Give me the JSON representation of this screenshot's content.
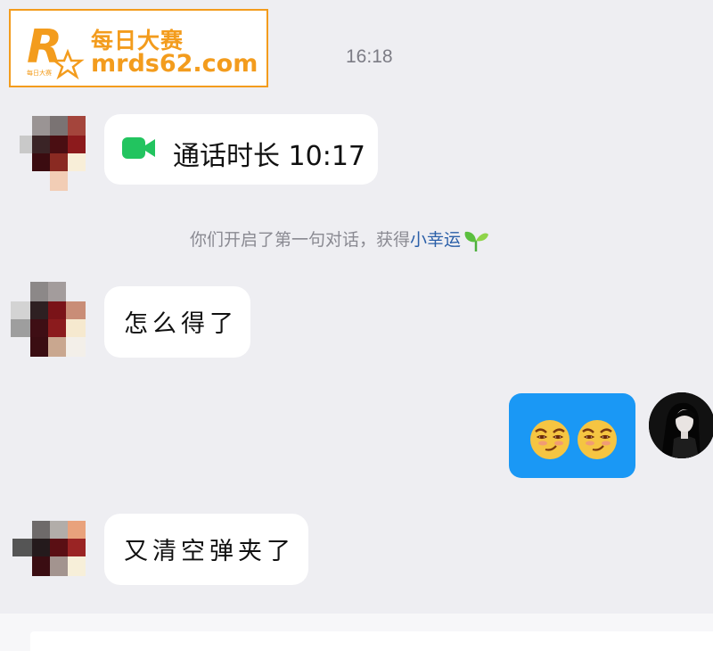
{
  "watermark": {
    "title": "每日大赛",
    "url": "mrds62.com",
    "logo_letter": "R",
    "logo_tag": "每日大赛",
    "color": "#f39c1d"
  },
  "timestamp": "16:18",
  "messages": [
    {
      "type": "call",
      "sender": "other",
      "icon": "video-camera-icon",
      "text": "通话时长 10:17"
    },
    {
      "type": "system",
      "text": "你们开启了第一句对话，获得",
      "link": "小幸运",
      "icon": "sprout-icon"
    },
    {
      "type": "text",
      "sender": "other",
      "text": "怎么得了"
    },
    {
      "type": "emoji",
      "sender": "self",
      "emojis": [
        "smirk-emoji-icon",
        "smirk-emoji-icon"
      ],
      "bubble_color": "#1a98f5"
    },
    {
      "type": "text",
      "sender": "other",
      "text": "又清空弹夹了"
    }
  ],
  "colors": {
    "background": "#eeeef2",
    "bubble": "#ffffff",
    "link": "#2a5fa8",
    "call_icon": "#22c45f"
  }
}
